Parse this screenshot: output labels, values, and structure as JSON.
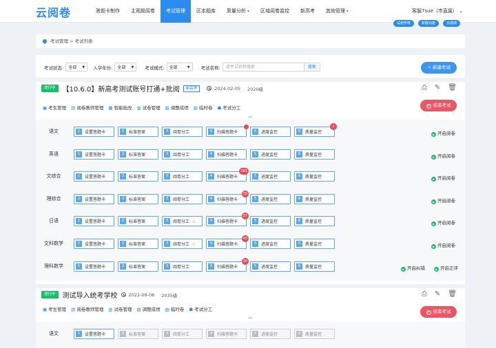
{
  "app": {
    "logo": "云阅卷",
    "user": "客服7sue（市直属）"
  },
  "nav": [
    {
      "label": "答题卡制作",
      "active": false,
      "caret": false
    },
    {
      "label": "主观题阅卷",
      "active": false,
      "caret": false
    },
    {
      "label": "考试管理",
      "active": true,
      "caret": false
    },
    {
      "label": "区本题库",
      "active": false,
      "caret": false
    },
    {
      "label": "质量分析",
      "active": false,
      "caret": true
    },
    {
      "label": "区域阅卷监控",
      "active": false,
      "caret": false
    },
    {
      "label": "新高考",
      "active": false,
      "caret": false
    },
    {
      "label": "其他管理",
      "active": false,
      "caret": true
    }
  ],
  "sub_tags": [
    "试用学校",
    "新版功能",
    "云成绩"
  ],
  "breadcrumb": "考试管理 > 考试列表",
  "filters": {
    "status_label": "考试状态:",
    "status_value": "全部",
    "year_label": "入学年份:",
    "year_value": "全部",
    "mode_label": "考试模式:",
    "mode_value": "全部",
    "name_label": "考试名称:",
    "name_placeholder": "请考试名称搜索",
    "search_btn": "搜索"
  },
  "new_exam_btn": "+ 新建考试",
  "end_btn": "结束考试",
  "exams": [
    {
      "status": "进行中",
      "title": "【10.6.0】新高考测试账号打通+批阅",
      "type_tag": "新高考",
      "date": "2024-02-05",
      "grade": "2020级",
      "actions": [
        "考生管理",
        "阅卷教师管理",
        "智能批改",
        "试卷管理",
        "调整成绩",
        "临时卷",
        "考试分工"
      ],
      "subjects": [
        {
          "name": "语文",
          "warn": false,
          "badges": {
            "4": "",
            "6": "1"
          },
          "open": "开启阅卷"
        },
        {
          "name": "英语",
          "warn": false,
          "badges": {},
          "open": "开启阅卷"
        },
        {
          "name": "文综合",
          "warn": false,
          "badges": {
            "4": "381"
          },
          "open": "开启阅卷"
        },
        {
          "name": "理综合",
          "warn": false,
          "badges": {
            "4": "29"
          },
          "open": "开启阅卷"
        },
        {
          "name": "日语",
          "warn": true,
          "badges": {
            "4": "37"
          },
          "open": "开启阅卷"
        },
        {
          "name": "文科数学",
          "warn": true,
          "badges": {
            "4": "40"
          },
          "open": "开启阅卷"
        },
        {
          "name": "理科数学",
          "warn": false,
          "badges": {
            "4": "30"
          },
          "open": "开启阅卷",
          "extra": "开启纠错"
        }
      ]
    },
    {
      "status": "进行中",
      "title": "测试导入统考学校",
      "date": "2022-09-06",
      "grade": "2035级",
      "actions": [
        "考生管理",
        "阅卷教师管理",
        "试卷管理",
        "调整成绩",
        "临时卷",
        "考试分工"
      ],
      "subjects": [
        {
          "name": "语文"
        }
      ]
    }
  ],
  "steps": [
    "设置答题卡",
    "标准答案",
    "阅卷分工",
    "扫描答题卡",
    "进度监控",
    "质量监控"
  ],
  "row_extra_right": "开启正评",
  "colors": {
    "primary": "#2b8cf0",
    "success": "#19be6b",
    "danger": "#ed5565"
  }
}
